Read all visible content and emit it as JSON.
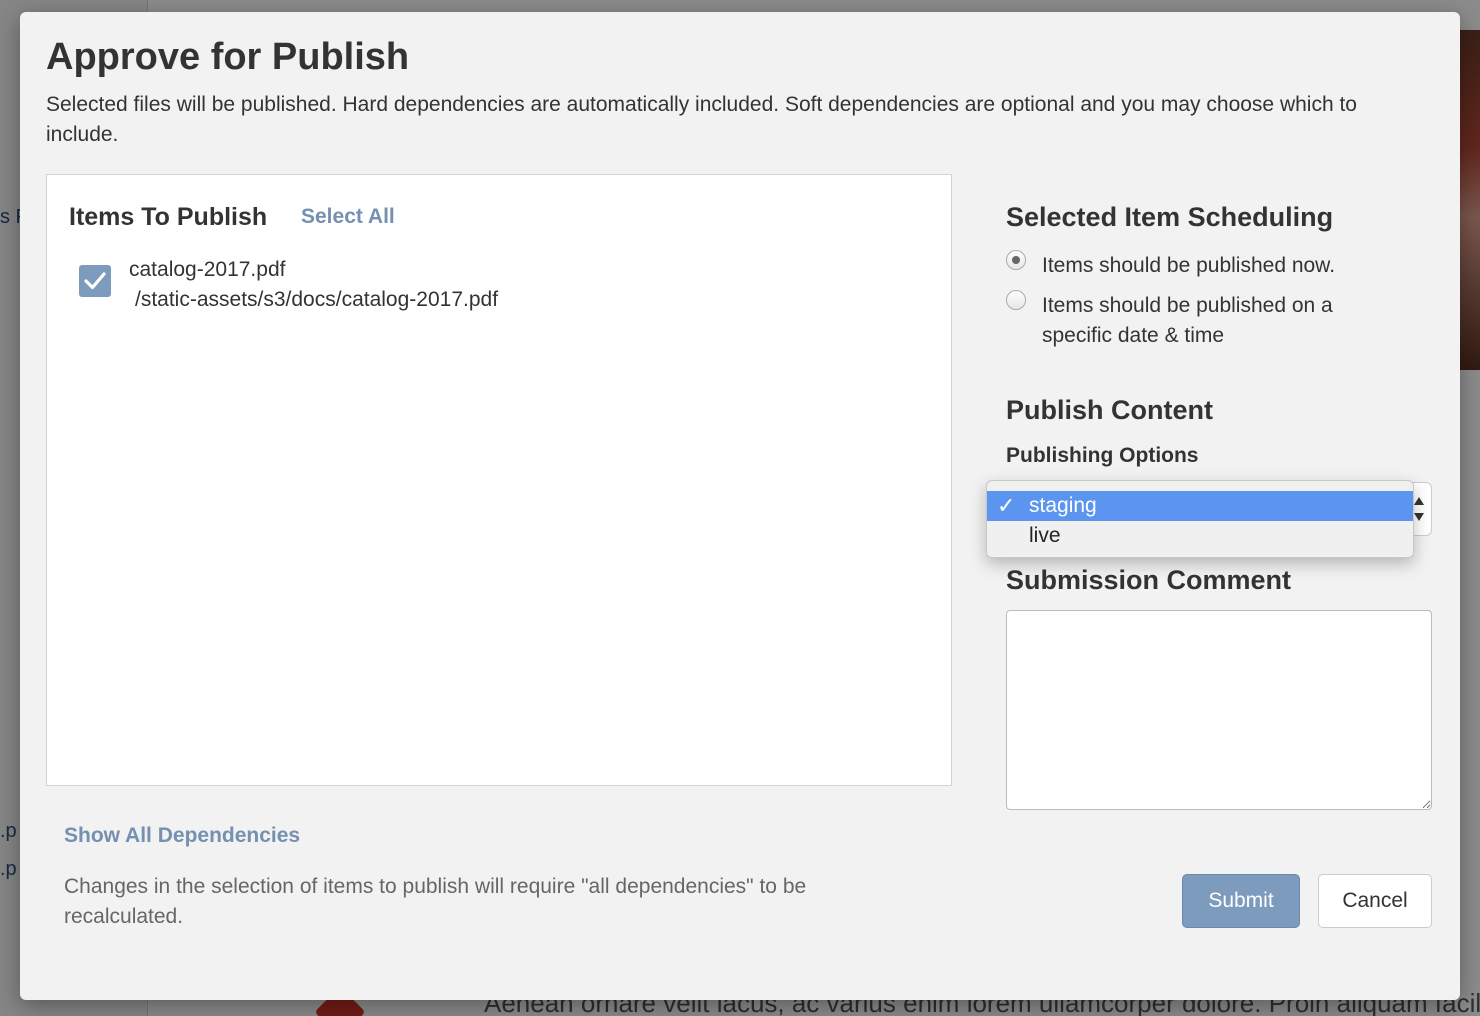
{
  "background": {
    "sidebar_fragments": [
      "s F",
      ".p",
      ".p"
    ],
    "bottom_text": "Aenean ornare velit lacus, ac varius enim lorem ullamcorper dolore. Proin aliquam facilisis"
  },
  "modal": {
    "title": "Approve for Publish",
    "description": "Selected files will be published. Hard dependencies are automatically included. Soft dependencies are optional and you may choose which to include."
  },
  "items": {
    "heading": "Items To Publish",
    "select_all": "Select All",
    "list": [
      {
        "name": "catalog-2017.pdf",
        "path": "/static-assets/s3/docs/catalog-2017.pdf",
        "checked": true
      }
    ]
  },
  "dependencies": {
    "show_all": "Show All Dependencies",
    "note": "Changes in the selection of items to publish will require \"all dependencies\" to be recalculated."
  },
  "scheduling": {
    "heading": "Selected Item Scheduling",
    "options": [
      {
        "label": "Items should be published now.",
        "selected": true
      },
      {
        "label": "Items should be published on a specific date & time",
        "selected": false
      }
    ]
  },
  "publish_content": {
    "heading": "Publish Content",
    "options_label": "Publishing Options",
    "options": [
      {
        "label": "staging",
        "selected": true
      },
      {
        "label": "live",
        "selected": false
      }
    ],
    "check_glyph": "✓"
  },
  "comment": {
    "heading": "Submission Comment",
    "value": ""
  },
  "buttons": {
    "submit": "Submit",
    "cancel": "Cancel"
  },
  "colors": {
    "accent": "#7d9bbd",
    "link": "#7590b0",
    "dropdown_highlight": "#5b95f0",
    "modal_bg": "#f2f2f2"
  },
  "icons": {
    "checkbox": "checkmark-icon",
    "select": "select-arrows-icon"
  }
}
